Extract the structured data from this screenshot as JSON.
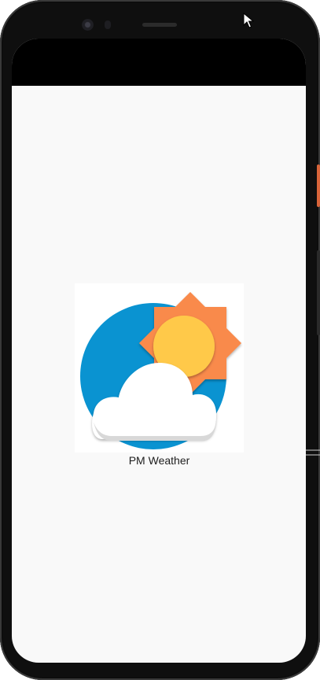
{
  "app": {
    "label": "PM Weather",
    "icon": "weather-sun-cloud-icon"
  },
  "colors": {
    "screen_bg": "#f9f9f9",
    "status_bar": "#000000",
    "sky_blue": "#0a93d1",
    "sun_outer": "#f98a4c",
    "sun_inner": "#ffc94a",
    "cloud": "#ffffff",
    "power_button": "#d9643a"
  }
}
